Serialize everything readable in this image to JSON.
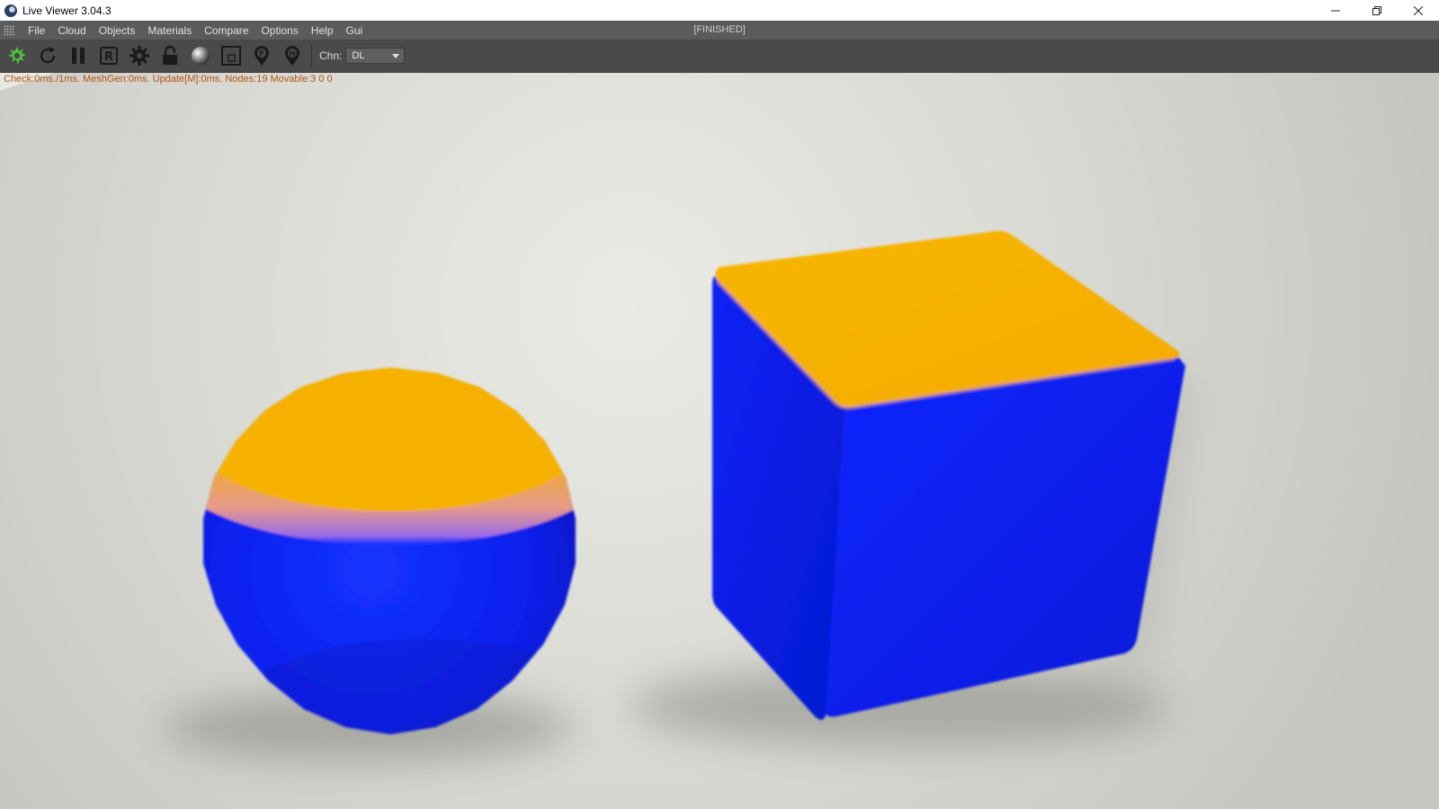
{
  "window": {
    "title": "Live Viewer 3.04.3",
    "icon": "octane-sphere-icon"
  },
  "menu": {
    "items": [
      "File",
      "Cloud",
      "Objects",
      "Materials",
      "Compare",
      "Options",
      "Help",
      "Gui"
    ],
    "status": "[FINISHED]"
  },
  "toolbar": {
    "tools": [
      {
        "name": "send-scene-icon",
        "color": "#4cc23a"
      },
      {
        "name": "refresh-icon"
      },
      {
        "name": "pause-icon"
      },
      {
        "name": "render-region-icon"
      },
      {
        "name": "settings-gear-icon"
      },
      {
        "name": "lock-icon"
      },
      {
        "name": "material-sphere-icon"
      },
      {
        "name": "clay-mode-icon"
      },
      {
        "name": "focus-picker-icon"
      },
      {
        "name": "material-picker-icon"
      }
    ],
    "channel_label": "Chn:",
    "channel_value": "DL"
  },
  "viewport": {
    "stats": "Check:0ms./1ms. MeshGen:0ms. Update[M]:0ms. Nodes:19 Movable:3  0 0",
    "objects": [
      {
        "name": "sphere",
        "top_color": "#f6b102",
        "body_color": "#0a1ff0"
      },
      {
        "name": "cube",
        "top_color": "#f6b102",
        "body_color": "#0a1ff0"
      }
    ]
  }
}
